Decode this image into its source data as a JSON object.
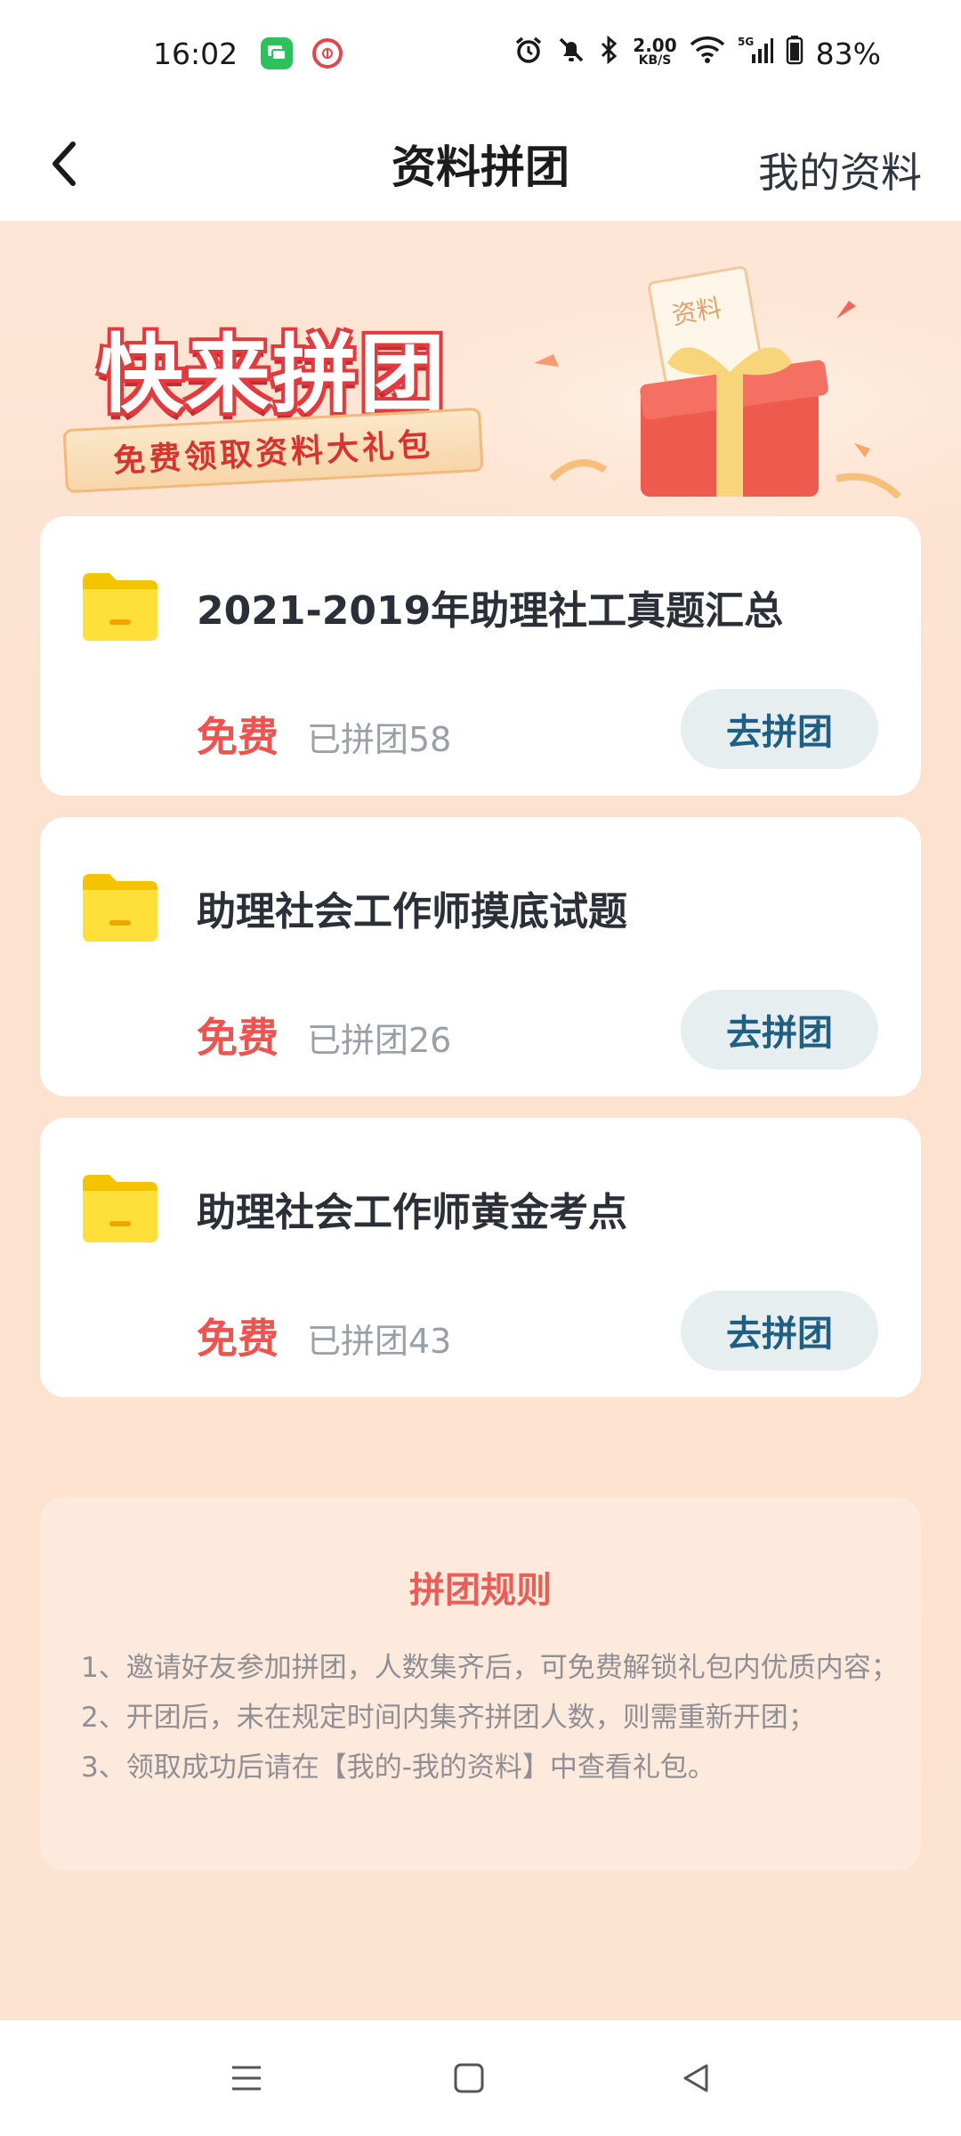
{
  "status_bar": {
    "time": "16:02",
    "net_speed_value": "2.00",
    "net_speed_unit": "KB/S",
    "battery": "83%",
    "icons": [
      "message-app-icon",
      "seal-app-icon",
      "alarm-icon",
      "mute-icon",
      "bluetooth-icon",
      "wifi-icon",
      "signal-5g-icon",
      "battery-icon"
    ]
  },
  "nav": {
    "title": "资料拼团",
    "right_link": "我的资料"
  },
  "banner": {
    "title": "快来拼团",
    "subtitle": "免费领取资料大礼包"
  },
  "items": [
    {
      "title": "2021-2019年助理社工真题汇总",
      "price": "免费",
      "count": "已拼团58",
      "button": "去拼团"
    },
    {
      "title": "助理社会工作师摸底试题",
      "price": "免费",
      "count": "已拼团26",
      "button": "去拼团"
    },
    {
      "title": "助理社会工作师黄金考点",
      "price": "免费",
      "count": "已拼团43",
      "button": "去拼团"
    }
  ],
  "rules": {
    "title": "拼团规则",
    "items": [
      "1、邀请好友参加拼团，人数集齐后，可免费解锁礼包内优质内容；",
      "2、开团后，未在规定时间内集齐拼团人数，则需重新开团；",
      "3、领取成功后请在【我的-我的资料】中查看礼包。"
    ]
  },
  "colors": {
    "page_bg": "#fde3d1",
    "free_red": "#ef5350",
    "button_bg": "#e6eef0",
    "button_text": "#1f5f84",
    "rules_title": "#ec5d57"
  }
}
